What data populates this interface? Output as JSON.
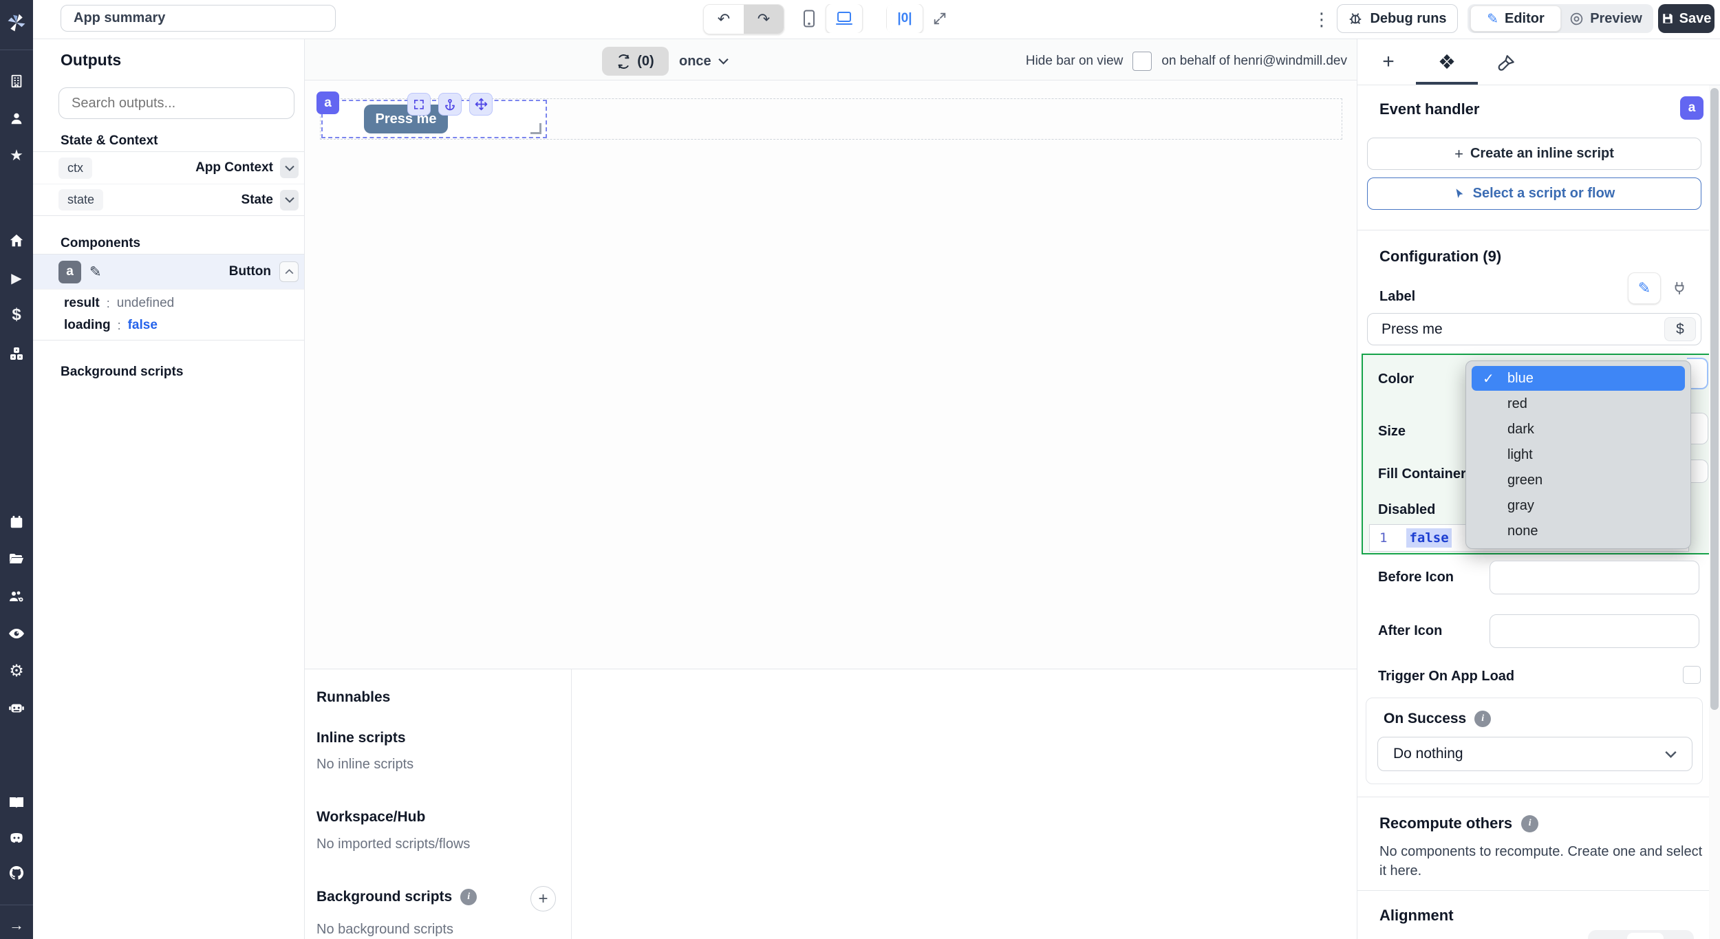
{
  "header": {
    "app_summary": "App summary",
    "kebab": "⋮",
    "debug_runs": "Debug runs",
    "editor": "Editor",
    "preview": "Preview",
    "save": "Save"
  },
  "canvas_toolbar": {
    "refresh_count": "(0)",
    "run_mode": "once",
    "hide_bar_label": "Hide bar on view",
    "on_behalf": "on behalf of henri@windmill.dev"
  },
  "canvas": {
    "component_id": "a",
    "button_label": "Press me"
  },
  "outputs": {
    "title": "Outputs",
    "search_placeholder": "Search outputs...",
    "state_context_title": "State & Context",
    "rows": [
      {
        "key": "ctx",
        "value": "App Context"
      },
      {
        "key": "state",
        "value": "State"
      }
    ],
    "components_title": "Components",
    "component": {
      "id": "a",
      "type": "Button",
      "props": [
        {
          "key": "result",
          "sep": ":",
          "value": "undefined"
        },
        {
          "key": "loading",
          "sep": ":",
          "value": "false"
        }
      ]
    },
    "background_title": "Background scripts"
  },
  "runnables": {
    "title": "Runnables",
    "inline_title": "Inline scripts",
    "inline_empty": "No inline scripts",
    "hub_title": "Workspace/Hub",
    "hub_empty": "No imported scripts/flows",
    "background_title": "Background scripts",
    "background_empty": "No background scripts"
  },
  "right": {
    "event_handler": "Event handler",
    "badge": "a",
    "create_inline": "Create an inline script",
    "select_script": "Select a script or flow",
    "configuration": "Configuration (9)",
    "label_field": {
      "label": "Label",
      "value": "Press me",
      "suffix": "$"
    },
    "color_label": "Color",
    "size_label": "Size",
    "fill_label": "Fill Container",
    "disabled_label": "Disabled",
    "disabled_editor": {
      "line": "1",
      "code": "false"
    },
    "color_options": [
      "blue",
      "red",
      "dark",
      "light",
      "green",
      "gray",
      "none"
    ],
    "selected_color": "blue",
    "before_icon_label": "Before Icon",
    "after_icon_label": "After Icon",
    "trigger_label": "Trigger On App Load",
    "on_success_label": "On Success",
    "on_success_value": "Do nothing",
    "recompute_label": "Recompute others",
    "recompute_text_1": "No components to recompute. Create one and select",
    "recompute_text_2": "it here.",
    "alignment_label": "Alignment"
  },
  "icons": {
    "check": "✓",
    "plus": "+",
    "dollar": "$",
    "star": "★",
    "play": "▶",
    "gear": "⚙",
    "arrow_right": "→",
    "pencil": "✎",
    "diamond": "❖",
    "undo": "↶",
    "redo": "↷",
    "align": "|0|"
  },
  "colors": {
    "accent": "#6366f1",
    "green_border": "#16a34a",
    "menu_highlight": "#3e86f6",
    "link_blue": "#2563eb",
    "save_bg": "#2d3442",
    "canvas_button": "#5d7d9f"
  }
}
